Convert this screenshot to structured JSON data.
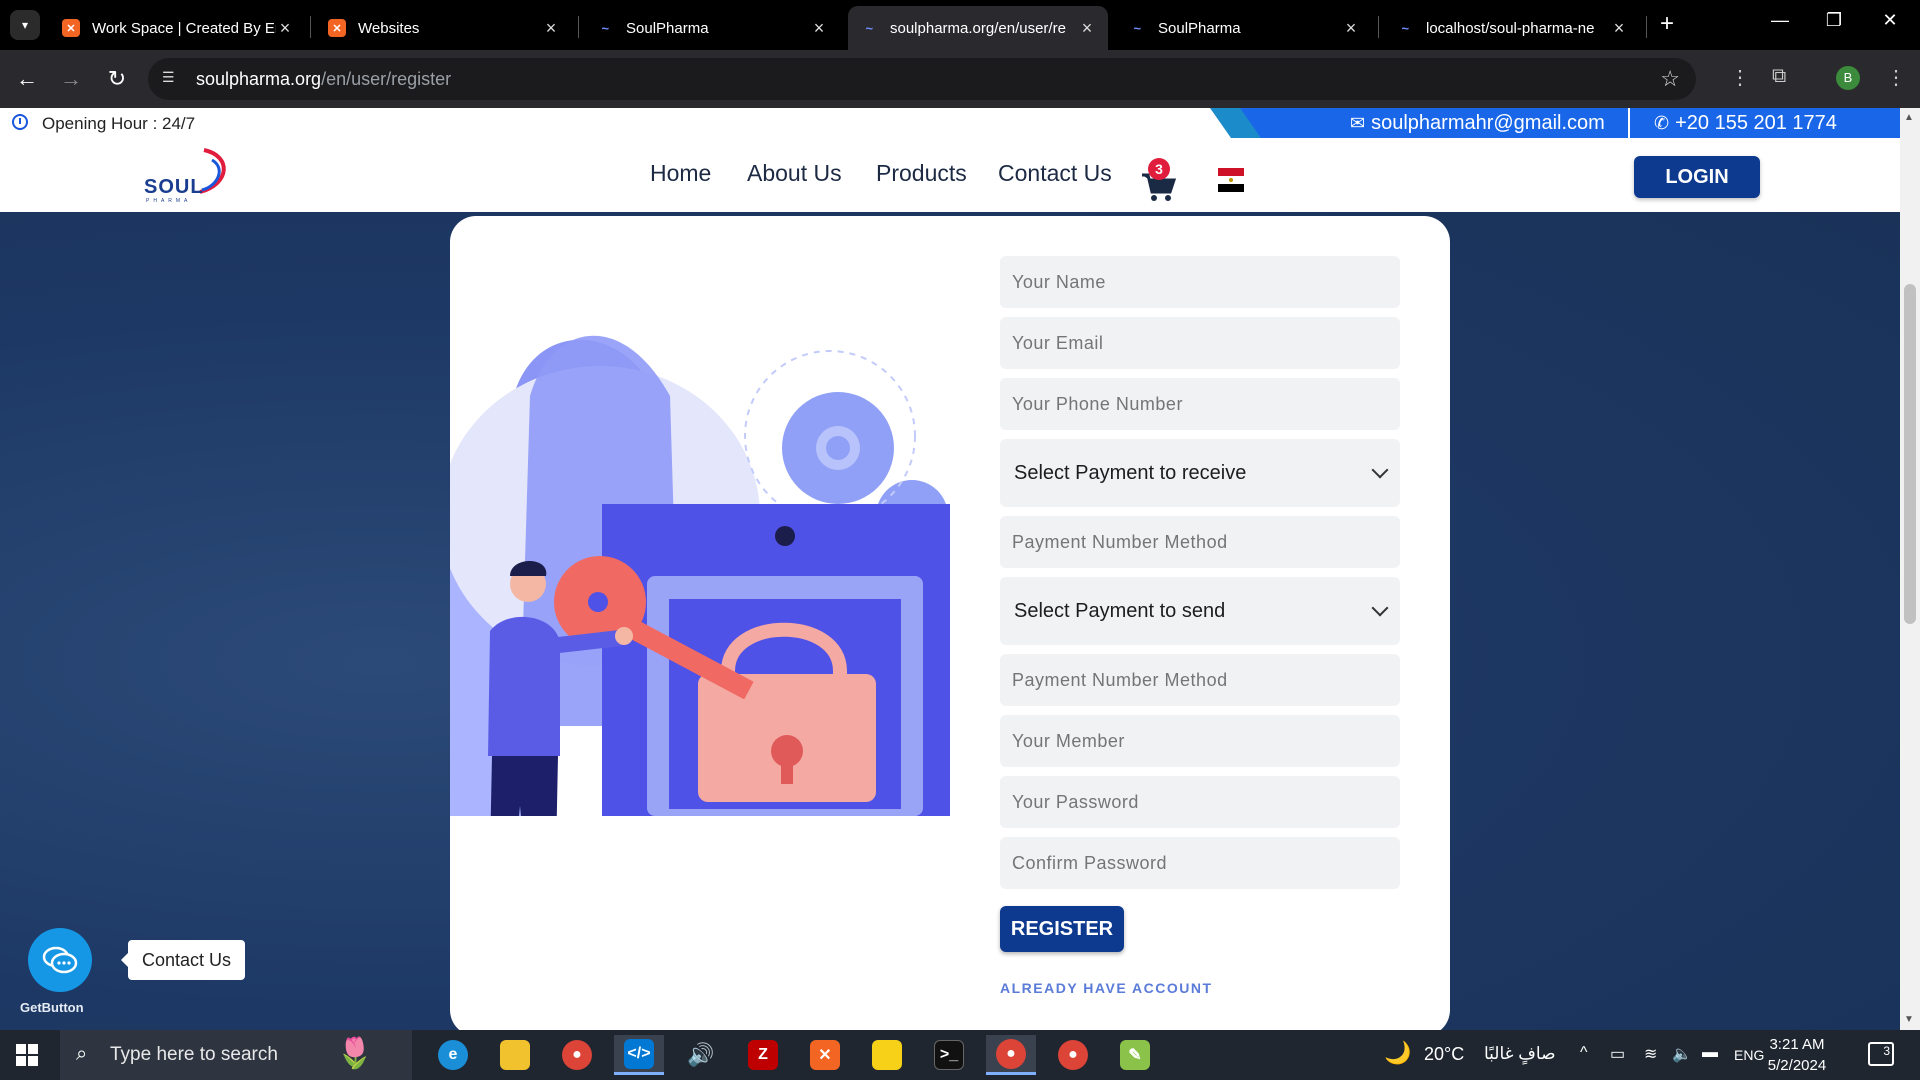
{
  "browser": {
    "tabs": [
      {
        "title": "Work Space | Created By En",
        "favicon": "xampp-icon",
        "active": false
      },
      {
        "title": "Websites",
        "favicon": "xampp-icon",
        "active": false
      },
      {
        "title": "SoulPharma",
        "favicon": "soulpharma-icon",
        "active": false
      },
      {
        "title": "soulpharma.org/en/user/re",
        "favicon": "soulpharma-icon",
        "active": true
      },
      {
        "title": "SoulPharma",
        "favicon": "soulpharma-icon",
        "active": false
      },
      {
        "title": "localhost/soul-pharma-ne",
        "favicon": "soulpharma-icon",
        "active": false
      }
    ],
    "url_host": "soulpharma.org",
    "url_path": "/en/user/register",
    "profile_initial": "B"
  },
  "site": {
    "topbar": {
      "opening": "Opening Hour : 24/7",
      "email": "soulpharmahr@gmail.com",
      "phone": "+20 155 201 1774"
    },
    "logo": {
      "word": "SOUL",
      "sub": "PHARMA"
    },
    "nav": [
      {
        "label": "Home"
      },
      {
        "label": "About Us"
      },
      {
        "label": "Products"
      },
      {
        "label": "Contact Us"
      }
    ],
    "cart_count": "3",
    "login_label": "LOGIN",
    "form": {
      "name_placeholder": "Your Name",
      "email_placeholder": "Your Email",
      "phone_placeholder": "Your Phone Number",
      "payment_receive_selected": "Select Payment to receive",
      "payment_receive_number_placeholder": "Payment Number Method",
      "payment_send_selected": "Select Payment to send",
      "payment_send_number_placeholder": "Payment Number Method",
      "member_placeholder": "Your Member",
      "password_placeholder": "Your Password",
      "confirm_placeholder": "Confirm Password",
      "register_label": "REGISTER",
      "already_label": "ALREADY HAVE ACCOUNT"
    },
    "floating": {
      "tooltip": "Contact Us",
      "brand": "GetButton"
    }
  },
  "taskbar": {
    "search_placeholder": "Type here to search",
    "weather": "20°C",
    "weather_desc": "صافٍ غالبًا",
    "language": "ENG",
    "time": "3:21 AM",
    "date": "5/2/2024",
    "notifications": "3"
  },
  "colors": {
    "brand_blue": "#0d3a8f",
    "topbar_blue": "#1967e8",
    "badge_red": "#e11d3d",
    "illustration_indigo": "#4f52e6"
  }
}
